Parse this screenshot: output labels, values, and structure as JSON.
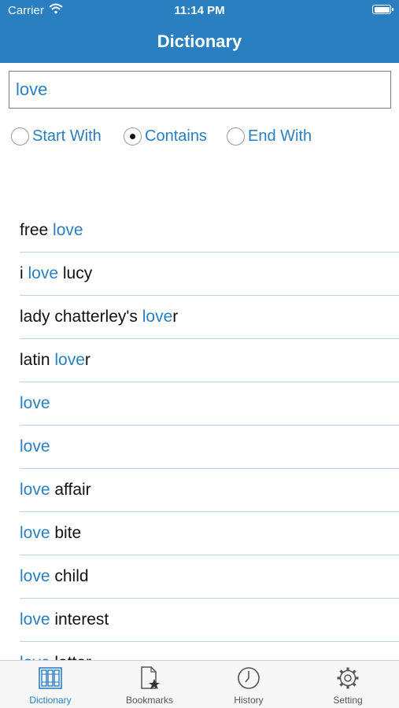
{
  "status": {
    "carrier": "Carrier",
    "time": "11:14 PM"
  },
  "nav": {
    "title": "Dictionary"
  },
  "search": {
    "value": "love",
    "placeholder": ""
  },
  "options": [
    {
      "label": "Start With",
      "selected": false
    },
    {
      "label": "Contains",
      "selected": true
    },
    {
      "label": "End With",
      "selected": false
    }
  ],
  "results": [
    {
      "pre": "free ",
      "match": "love",
      "post": ""
    },
    {
      "pre": "i ",
      "match": "love",
      "post": " lucy"
    },
    {
      "pre": "lady chatterley's ",
      "match": "love",
      "post": "r"
    },
    {
      "pre": "latin ",
      "match": "love",
      "post": "r"
    },
    {
      "pre": "",
      "match": "love",
      "post": ""
    },
    {
      "pre": "",
      "match": "love",
      "post": ""
    },
    {
      "pre": "",
      "match": "love",
      "post": " affair"
    },
    {
      "pre": "",
      "match": "love",
      "post": " bite"
    },
    {
      "pre": "",
      "match": "love",
      "post": " child"
    },
    {
      "pre": "",
      "match": "love",
      "post": " interest"
    },
    {
      "pre": "",
      "match": "love",
      "post": " letter"
    }
  ],
  "tabs": [
    {
      "label": "Dictionary",
      "icon": "books-icon",
      "active": true
    },
    {
      "label": "Bookmarks",
      "icon": "bookmark-document-icon",
      "active": false
    },
    {
      "label": "History",
      "icon": "clock-icon",
      "active": false
    },
    {
      "label": "Setting",
      "icon": "gear-icon",
      "active": false
    }
  ],
  "colors": {
    "accent": "#2a7fc1",
    "separator": "#b9d3e6"
  }
}
